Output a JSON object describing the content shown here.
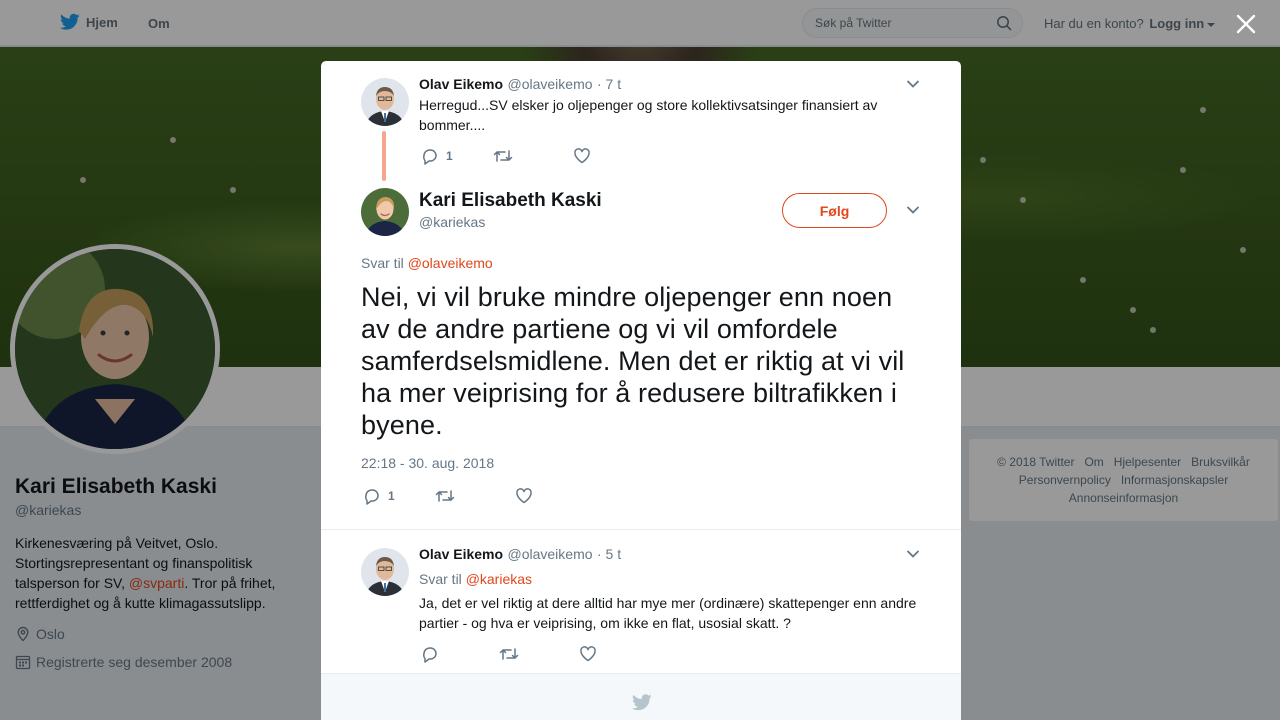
{
  "topbar": {
    "home_label": "Hjem",
    "about_label": "Om",
    "search_placeholder": "Søk på Twitter",
    "account_prompt": "Har du en konto?",
    "login_label": "Logg inn"
  },
  "profile": {
    "name": "Kari Elisabeth Kaski",
    "handle": "@kariekas",
    "bio_part1": "Kirkenesværing på Veitvet, Oslo. Stortingsrepresentant og finanspolitisk talsperson for SV, ",
    "bio_link": "@svparti",
    "bio_part2": ". Tror på frihet, rettferdighet og å kutte klimagassutslipp.",
    "location": "Oslo",
    "joined": "Registrerte seg desember 2008"
  },
  "footer": {
    "items": [
      "© 2018 Twitter",
      "Om",
      "Hjelpesenter",
      "Bruksvilkår",
      "Personvernpolicy",
      "Informasjonskapsler",
      "Annonseinformasjon"
    ]
  },
  "modal": {
    "parent_tweet": {
      "name": "Olav Eikemo",
      "handle": "@olaveikemo",
      "time": "· 7 t",
      "text": "Herregud...SV elsker jo oljepenger og store kollektivsatsinger finansiert av bommer....",
      "reply_count": "1"
    },
    "main_tweet": {
      "name": "Kari Elisabeth Kaski",
      "handle": "@kariekas",
      "follow_label": "Følg",
      "reply_to_label": "Svar til",
      "reply_to_handle": "@olaveikemo",
      "text": "Nei, vi vil bruke mindre oljepenger enn noen av de andre partiene og vi vil omfordele samferdselsmidlene. Men det er riktig at vi vil ha mer veiprising for å redusere biltrafikken i byene.",
      "timestamp": "22:18 - 30. aug. 2018",
      "reply_count": "1"
    },
    "reply_tweet": {
      "name": "Olav Eikemo",
      "handle": "@olaveikemo",
      "time": "· 5 t",
      "reply_to_label": "Svar til",
      "reply_to_handle": "@kariekas",
      "text": "Ja, det er vel riktig at dere alltid har mye mer (ordinære) skattepenger enn andre partier - og hva er veiprising, om ikke en flat, usosial skatt.  ?"
    }
  },
  "colors": {
    "accent": "#e0471a",
    "secondary_text": "#657786",
    "thread_line": "#f7a58c",
    "twitter_blue": "#1da1f2"
  },
  "icons": [
    "twitter-bird-icon",
    "search-icon",
    "close-icon",
    "chevron-down-icon",
    "reply-icon",
    "retweet-icon",
    "like-icon",
    "location-icon",
    "calendar-icon"
  ]
}
